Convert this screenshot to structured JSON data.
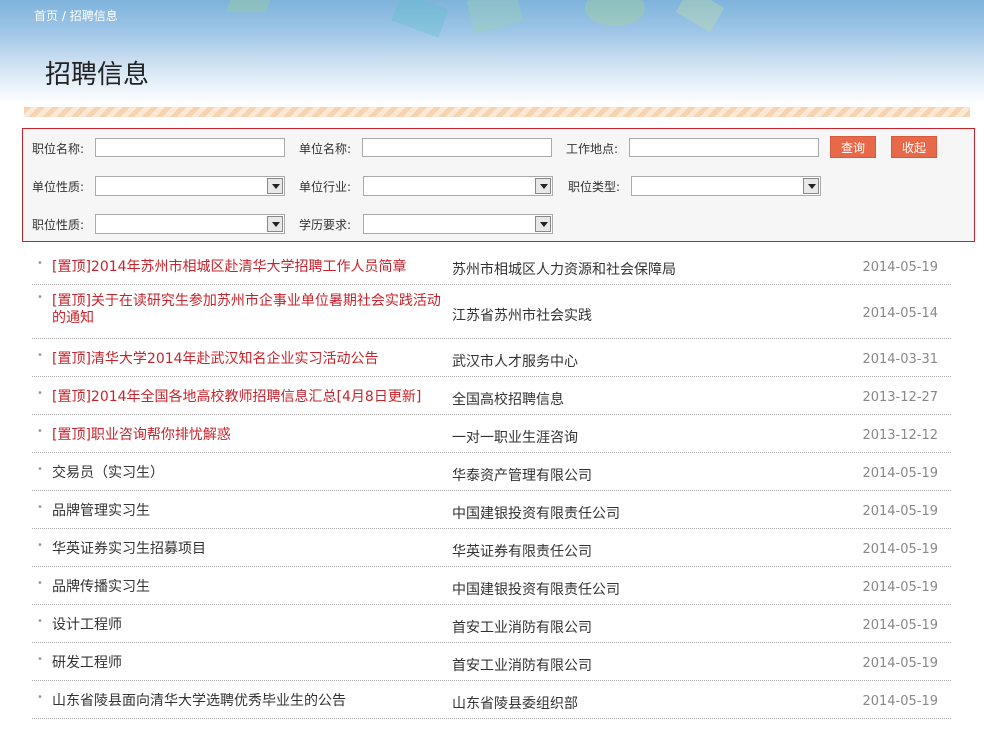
{
  "breadcrumb": {
    "home": "首页",
    "separator": "/",
    "current": "招聘信息"
  },
  "page_title": "招聘信息",
  "search": {
    "position_name_label": "职位名称:",
    "company_name_label": "单位名称:",
    "location_label": "工作地点:",
    "company_nature_label": "单位性质:",
    "company_industry_label": "单位行业:",
    "position_type_label": "职位类型:",
    "position_nature_label": "职位性质:",
    "education_label": "学历要求:",
    "query_button": "查询",
    "collapse_button": "收起"
  },
  "listings": [
    {
      "title": "[置顶]2014年苏州市相城区赴清华大学招聘工作人员简章",
      "org": "苏州市相城区人力资源和社会保障局",
      "date": "2014-05-19",
      "pinned": true
    },
    {
      "title": "[置顶]关于在读研究生参加苏州市企事业单位暑期社会实践活动的通知",
      "org": "江苏省苏州市社会实践",
      "date": "2014-05-14",
      "pinned": true
    },
    {
      "title": "[置顶]清华大学2014年赴武汉知名企业实习活动公告",
      "org": "武汉市人才服务中心",
      "date": "2014-03-31",
      "pinned": true
    },
    {
      "title": "[置顶]2014年全国各地高校教师招聘信息汇总[4月8日更新]",
      "org": "全国高校招聘信息",
      "date": "2013-12-27",
      "pinned": true
    },
    {
      "title": "[置顶]职业咨询帮你排忧解惑",
      "org": "一对一职业生涯咨询",
      "date": "2013-12-12",
      "pinned": true
    },
    {
      "title": "交易员（实习生）",
      "org": "华泰资产管理有限公司",
      "date": "2014-05-19",
      "pinned": false
    },
    {
      "title": "品牌管理实习生",
      "org": "中国建银投资有限责任公司",
      "date": "2014-05-19",
      "pinned": false
    },
    {
      "title": "华英证券实习生招募项目",
      "org": "华英证券有限责任公司",
      "date": "2014-05-19",
      "pinned": false
    },
    {
      "title": "品牌传播实习生",
      "org": "中国建银投资有限责任公司",
      "date": "2014-05-19",
      "pinned": false
    },
    {
      "title": "设计工程师",
      "org": "首安工业消防有限公司",
      "date": "2014-05-19",
      "pinned": false
    },
    {
      "title": "研发工程师",
      "org": "首安工业消防有限公司",
      "date": "2014-05-19",
      "pinned": false
    },
    {
      "title": "山东省陵县面向清华大学选聘优秀毕业生的公告",
      "org": "山东省陵县委组织部",
      "date": "2014-05-19",
      "pinned": false
    }
  ],
  "colors": {
    "pinned_title": "#c8232c",
    "button": "#e8694a",
    "search_border": "#c8232c"
  }
}
